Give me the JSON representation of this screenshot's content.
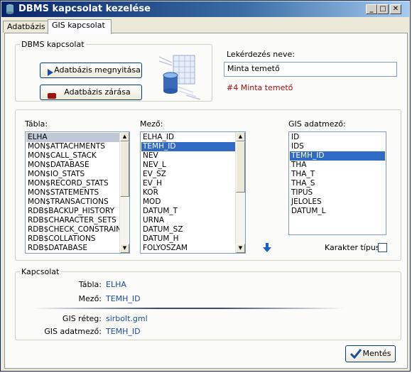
{
  "window": {
    "title": "DBMS kapcsolat kezelése"
  },
  "titlebar_buttons": {
    "minimize": "_",
    "maximize": "□",
    "close": "✕"
  },
  "tabs": [
    {
      "label": "Adatbázis"
    },
    {
      "label": "GIS kapcsolat"
    }
  ],
  "dbms_group": {
    "legend": "DBMS kapcsolat",
    "open_button": "Adatbázis megnyitása",
    "close_button": "Adatbázis zárása"
  },
  "query": {
    "label": "Lekérdezés neve:",
    "value": "Minta temető",
    "status": "#4 Minta temető",
    "status_color": "#a01010"
  },
  "table_list": {
    "label": "Tábla:",
    "items": [
      "ELHA",
      "MON$ATTACHMENTS",
      "MON$CALL_STACK",
      "MON$DATABASE",
      "MON$IO_STATS",
      "MON$RECORD_STATS",
      "MON$STATEMENTS",
      "MON$TRANSACTIONS",
      "RDB$BACKUP_HISTORY",
      "RDB$CHARACTER_SETS",
      "RDB$CHECK_CONSTRAINTS",
      "RDB$COLLATIONS",
      "RDB$DATABASE"
    ],
    "selected_index": 0
  },
  "field_list": {
    "label": "Mező:",
    "items": [
      "ELHA_ID",
      "TEMH_ID",
      "NEV",
      "NEV_L",
      "EV_SZ",
      "EV_H",
      "KOR",
      "MOD",
      "DATUM_T",
      "URNA",
      "DATUM_SZ",
      "DATUM_H",
      "FOLYOSZAM"
    ],
    "selected_index": 1
  },
  "gis_list": {
    "label": "GIS adatmező:",
    "items": [
      "ID",
      "IDS",
      "TEMH_ID",
      "THA",
      "THA_T",
      "THA_S",
      "TIPUS",
      "JELOLES",
      "DATUM_L"
    ],
    "selected_index": 2
  },
  "type_checkbox": {
    "label": "Karakter típus",
    "checked": false
  },
  "connection": {
    "legend": "Kapcsolat",
    "table_label": "Tábla:",
    "table_value": "ELHA",
    "field_label": "Mező:",
    "field_value": "TEMH_ID",
    "layer_label": "GIS réteg:",
    "layer_value": "sirbolt.gml",
    "gisfield_label": "GIS adatmező:",
    "gisfield_value": "TEMH_ID"
  },
  "save_button": {
    "label": "Mentés"
  },
  "colors": {
    "accent": "#316ac5",
    "link_value": "#1c4b9c",
    "title_start": "#0a246a"
  },
  "icons": {
    "window": "database-app-icon",
    "open": "play-arrow-icon",
    "close": "stop-icon",
    "arrow": "arrow-down-icon",
    "save": "checkmark-icon",
    "database": "database-table-icon"
  }
}
